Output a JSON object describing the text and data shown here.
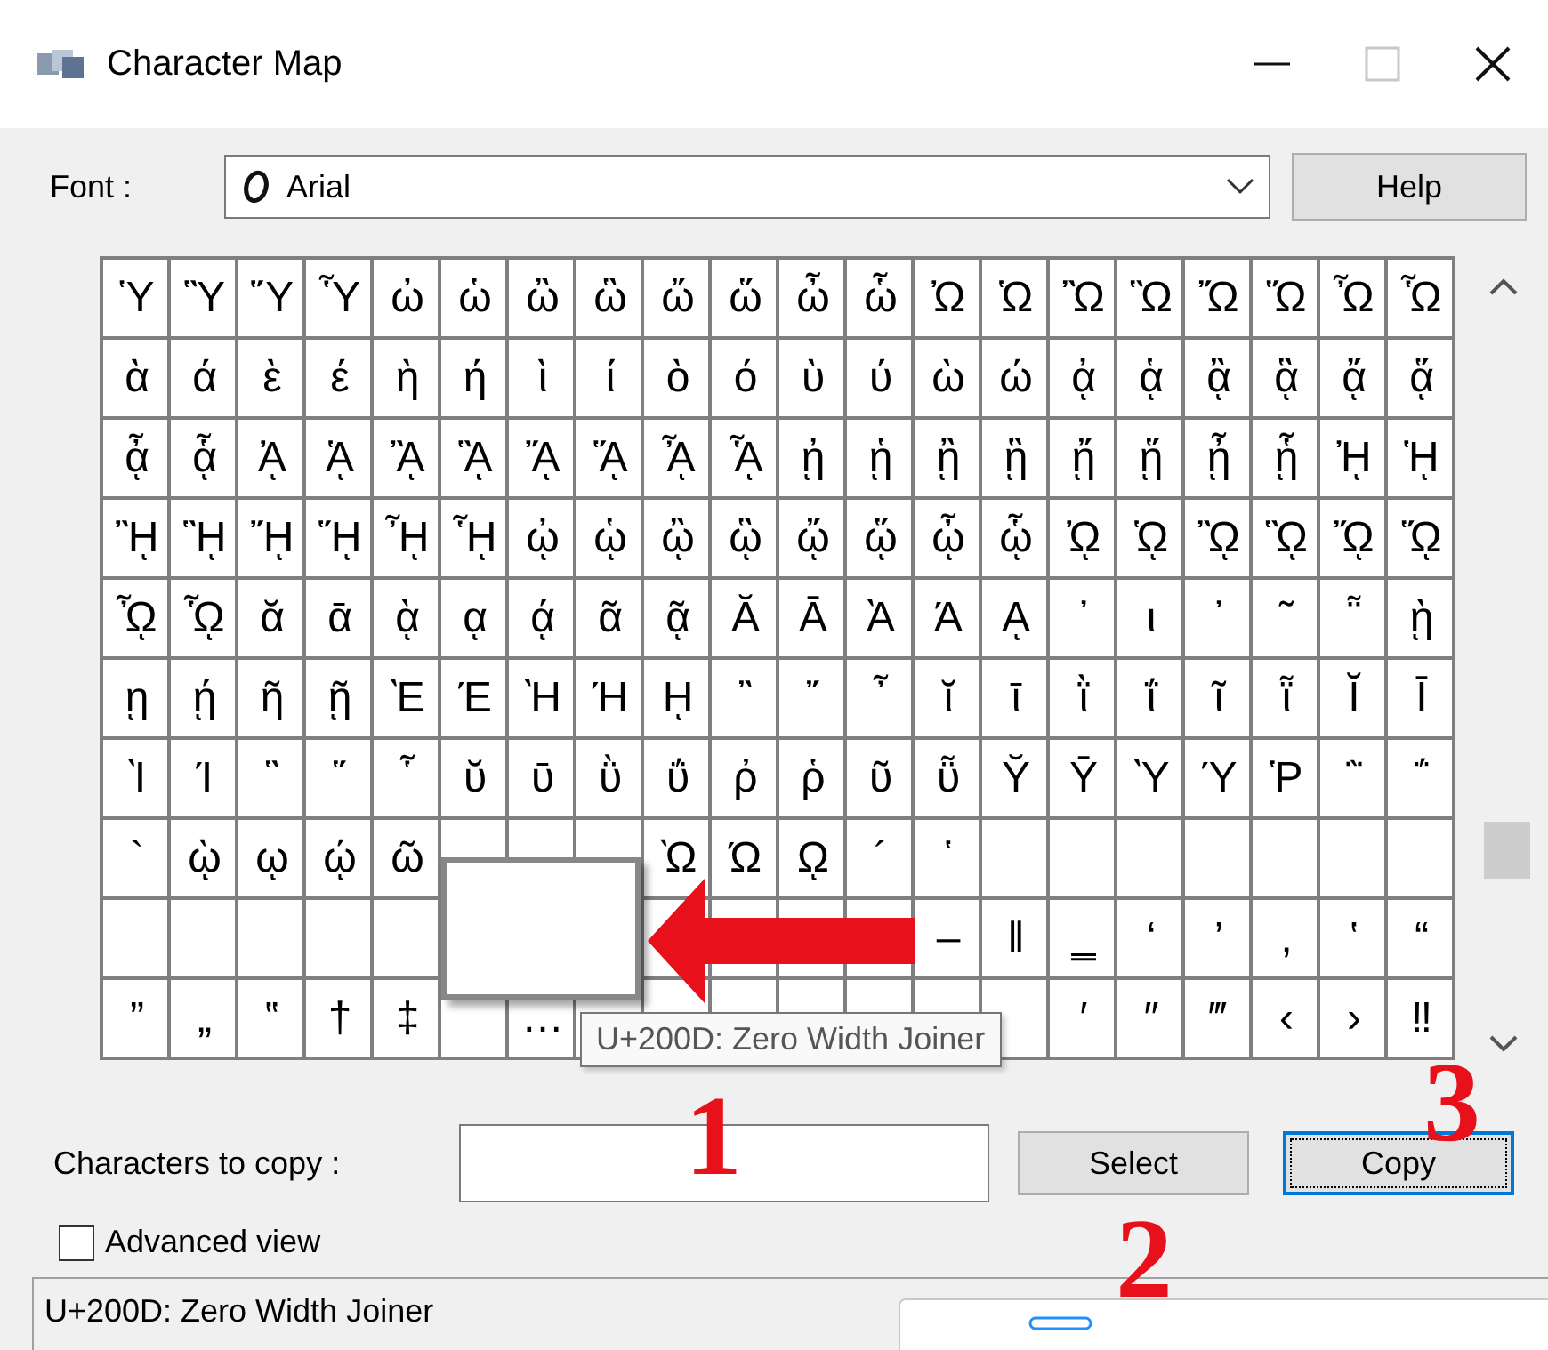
{
  "window": {
    "title": "Character Map",
    "controls": [
      {
        "kind": "minimize",
        "disabled": false
      },
      {
        "kind": "maximize",
        "disabled": true
      },
      {
        "kind": "close",
        "disabled": false
      }
    ]
  },
  "font": {
    "label": "Font :",
    "value": "Arial"
  },
  "help_button": {
    "label": "Help"
  },
  "grid": {
    "rows": [
      [
        "Ὑ",
        "Ὓ",
        "Ὕ",
        "Ὗ",
        "ὠ",
        "ὡ",
        "ὢ",
        "ὣ",
        "ὤ",
        "ὥ",
        "ὦ",
        "ὧ",
        "Ὠ",
        "Ὡ",
        "Ὢ",
        "Ὣ",
        "Ὤ",
        "Ὥ",
        "Ὦ",
        "Ὧ"
      ],
      [
        "ὰ",
        "ά",
        "ὲ",
        "έ",
        "ὴ",
        "ή",
        "ὶ",
        "ί",
        "ὸ",
        "ό",
        "ὺ",
        "ύ",
        "ὼ",
        "ώ",
        "ᾀ",
        "ᾁ",
        "ᾂ",
        "ᾃ",
        "ᾄ",
        "ᾅ"
      ],
      [
        "ᾆ",
        "ᾇ",
        "ᾈ",
        "ᾉ",
        "ᾊ",
        "ᾋ",
        "ᾌ",
        "ᾍ",
        "ᾎ",
        "ᾏ",
        "ᾐ",
        "ᾑ",
        "ᾒ",
        "ᾓ",
        "ᾔ",
        "ᾕ",
        "ᾖ",
        "ᾗ",
        "ᾘ",
        "ᾙ"
      ],
      [
        "ᾚ",
        "ᾛ",
        "ᾜ",
        "ᾝ",
        "ᾞ",
        "ᾟ",
        "ᾠ",
        "ᾡ",
        "ᾢ",
        "ᾣ",
        "ᾤ",
        "ᾥ",
        "ᾦ",
        "ᾧ",
        "ᾨ",
        "ᾩ",
        "ᾪ",
        "ᾫ",
        "ᾬ",
        "ᾭ"
      ],
      [
        "ᾮ",
        "ᾯ",
        "ᾰ",
        "ᾱ",
        "ᾲ",
        "ᾳ",
        "ᾴ",
        "ᾶ",
        "ᾷ",
        "Ᾰ",
        "Ᾱ",
        "Ὰ",
        "Ά",
        "ᾼ",
        "᾽",
        "ι",
        "᾿",
        "῀",
        "῁",
        "ῂ"
      ],
      [
        "ῃ",
        "ῄ",
        "ῆ",
        "ῇ",
        "Ὲ",
        "Έ",
        "Ὴ",
        "Ή",
        "ῌ",
        "῍",
        "῎",
        "῏",
        "ῐ",
        "ῑ",
        "ῒ",
        "ΐ",
        "ῖ",
        "ῗ",
        "Ῐ",
        "Ῑ"
      ],
      [
        "Ὶ",
        "Ί",
        "῝",
        "῞",
        "῟",
        "ῠ",
        "ῡ",
        "ῢ",
        "ΰ",
        "ῤ",
        "ῥ",
        "ῦ",
        "ῧ",
        "Ῠ",
        "Ῡ",
        "Ὺ",
        "Ύ",
        "Ῥ",
        "῭",
        "΅"
      ],
      [
        "`",
        "ῲ",
        "ῳ",
        "ῴ",
        "ῶ",
        null,
        null,
        null,
        "Ὼ",
        "Ώ",
        "ῼ",
        "´",
        "῾",
        null,
        null,
        null,
        null,
        null,
        null,
        null
      ],
      [
        null,
        null,
        null,
        null,
        null,
        null,
        null,
        null,
        null,
        null,
        null,
        null,
        "–",
        "‖",
        "‗",
        "‘",
        "’",
        "‚",
        "‛",
        "“"
      ],
      [
        "”",
        "„",
        "‟",
        "†",
        "‡",
        null,
        "…",
        null,
        null,
        null,
        null,
        null,
        null,
        null,
        "′",
        "″",
        "‴",
        "‹",
        "›",
        "‼"
      ]
    ]
  },
  "tooltip": "U+200D: Zero Width Joiner",
  "annotations": [
    "1",
    "2",
    "3"
  ],
  "copy_field": {
    "label": "Characters to copy :"
  },
  "buttons": [
    {
      "label": "Select",
      "focused": false
    },
    {
      "label": "Copy",
      "focused": true
    }
  ],
  "advanced_view": {
    "label": "Advanced view",
    "checked": false
  },
  "status_bar": "U+200D: Zero Width Joiner"
}
